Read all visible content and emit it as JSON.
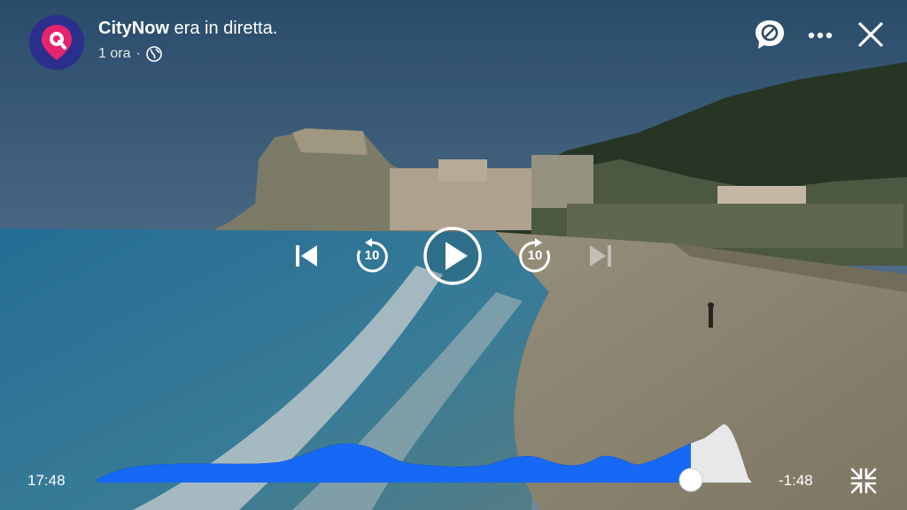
{
  "header": {
    "channel_name": "CityNow",
    "status_text": " era in diretta.",
    "age": "1 ora",
    "separator": "·",
    "audience_icon": "globe-icon",
    "avatar_icon": "map-pin-logo-icon"
  },
  "top_actions": [
    {
      "name": "comments-off-button",
      "icon": "comment-off-icon"
    },
    {
      "name": "more-options-button",
      "icon": "ellipsis-icon"
    },
    {
      "name": "close-button",
      "icon": "close-icon"
    }
  ],
  "controls": {
    "previous": "skip-previous-icon",
    "rewind_seconds": "10",
    "play": "play-icon",
    "forward_seconds": "10",
    "next": "skip-next-icon"
  },
  "timeline": {
    "elapsed": "17:48",
    "remaining": "-1:48",
    "progress_fraction": 0.9,
    "exit_fullscreen_icon": "minimize-icon"
  },
  "colors": {
    "progress": "#1668f5",
    "remaining_track": "#e8e8ea",
    "avatar_bg": "#2b2f8c",
    "logo_pink": "#e5246e"
  }
}
